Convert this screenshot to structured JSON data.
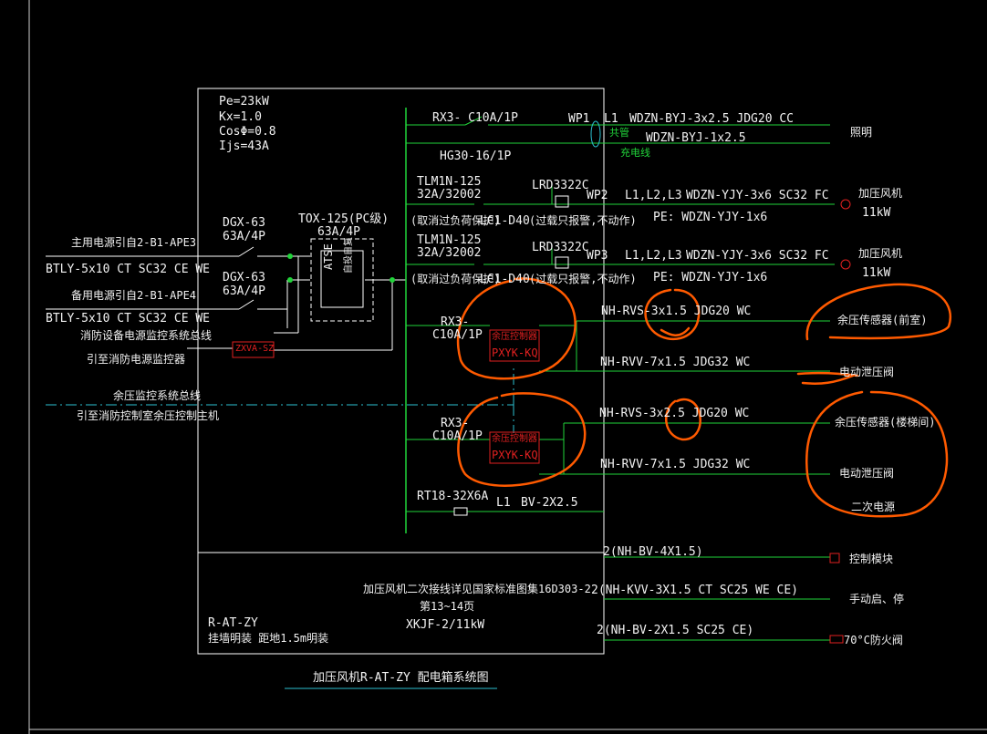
{
  "colors": {
    "background": "#000000",
    "line": "#ffffff",
    "feeder": "#21d43a",
    "module": "#e02020",
    "markup": "#ff5a00",
    "title_underline": "#2bc0d0"
  },
  "box": {
    "load_pe": "Pe=23kW",
    "load_kx": "Kx=1.0",
    "load_cos": "CosΦ=0.8",
    "load_ijs": "Ijs=43A",
    "main_breaker_a": {
      "model": "DGX-63",
      "rating": "63A/4P"
    },
    "main_breaker_b": {
      "model": "DGX-63",
      "rating": "63A/4P"
    },
    "ats": {
      "model": "TOX-125(PC级)",
      "rating": "63A/4P",
      "label": "ATSE",
      "sublabel": "自投自复"
    },
    "monitor_module": "ZXVA-SZ",
    "footer_name": "R-AT-ZY",
    "footer_install": "挂墙明装 距地1.5m明装",
    "footer_note": "加压风机二次接线详见国家标准图集16D303-2",
    "footer_page": "第13~14页",
    "footer_model": "XKJF-2/11kW"
  },
  "left": {
    "supply_main": "主用电源引自2-B1-APE3",
    "supply_main_cable": "BTLY-5x10 CT SC32 CE WE",
    "supply_backup": "备用电源引自2-B1-APE4",
    "supply_backup_cable": "BTLY-5x10 CT SC32 CE WE",
    "monitor_bus": "消防设备电源监控系统总线",
    "monitor_dest": "引至消防电源监控器",
    "pressure_bus": "余压监控系统总线",
    "pressure_dest": "引至消防控制室余压控制主机"
  },
  "branches": {
    "wp1": {
      "breaker": "RX3- C10A/1P",
      "device": "HG30-16/1P",
      "circuit": "WP1",
      "phase": "L1",
      "cable": "WDZN-BYJ-3x2.5 JDG20 CC",
      "cable2": "WDZN-BYJ-1x2.5",
      "note_shared": "共管",
      "note_charge": "充电线",
      "load": "照明"
    },
    "wp2": {
      "breaker": "TLM1N-125",
      "breaker_rating": "32A/32002",
      "note": "(取消过负荷保护)",
      "contactor": "LC1-D40",
      "relay": "LRD3322C",
      "relay_note": "(过载只报警,不动作)",
      "circuit": "WP2",
      "phase": "L1,L2,L3",
      "cable": "WDZN-YJY-3x6 SC32 FC",
      "pe": "PE: WDZN-YJY-1x6",
      "load": "加压风机",
      "power": "11kW"
    },
    "wp3": {
      "breaker": "TLM1N-125",
      "breaker_rating": "32A/32002",
      "note": "(取消过负荷保护)",
      "contactor": "LC1-D40",
      "relay": "LRD3322C",
      "relay_note": "(过载只报警,不动作)",
      "circuit": "WP3",
      "phase": "L1,L2,L3",
      "cable": "WDZN-YJY-3x6 SC32 FC",
      "pe": "PE: WDZN-YJY-1x6",
      "load": "加压风机",
      "power": "11kW"
    },
    "ctrl1": {
      "breaker": "RX3-",
      "breaker_rating": "C10A/1P",
      "module": "余压控制器",
      "module_model": "PXYK-KQ",
      "cable_a": "NH-RVS-3x1.5 JDG20 WC",
      "load_a": "余压传感器(前室)",
      "cable_b": "NH-RVV-7x1.5 JDG32 WC",
      "load_b": "电动泄压阀"
    },
    "ctrl2": {
      "breaker": "RX3-",
      "breaker_rating": "C10A/1P",
      "module": "余压控制器",
      "module_model": "PXYK-KQ",
      "cable_a": "NH-RVS-3x2.5 JDG20 WC",
      "load_a": "余压传感器(楼梯间)",
      "cable_b": "NH-RVV-7x1.5 JDG32 WC",
      "load_b": "电动泄压阀",
      "load_c": "二次电源"
    },
    "spare": {
      "fuse": "RT18-32X6A",
      "phase": "L1",
      "cable": "BV-2X2.5"
    }
  },
  "secondary": {
    "s1_cable": "2(NH-BV-4X1.5)",
    "s1_load": "控制模块",
    "s2_cable": "2(NH-KVV-3X1.5 CT SC25 WE CE)",
    "s2_load": "手动启、停",
    "s3_cable": "2(NH-BV-2X1.5 SC25 CE)",
    "s3_load": "70°C防火阀"
  },
  "caption": "加压风机R-AT-ZY 配电箱系统图"
}
